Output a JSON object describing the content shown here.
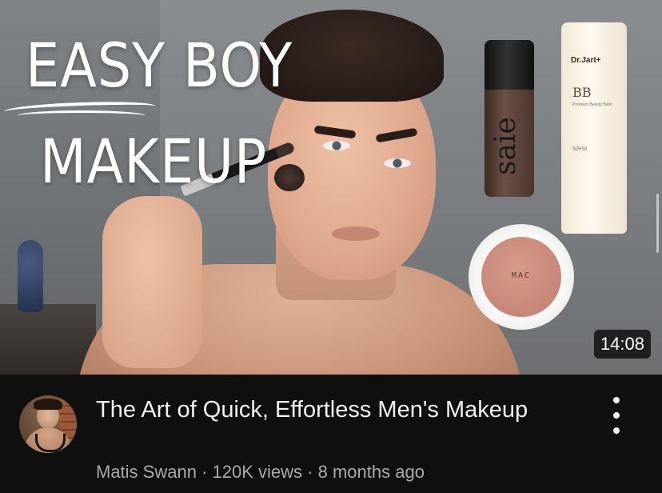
{
  "thumbnail": {
    "headline_line1": "EASY BOY",
    "headline_line2": "MAKEUP",
    "duration": "14:08",
    "products": {
      "foundation_label": "saie",
      "tube_brand": "Dr.Jart+",
      "tube_bb": "BB",
      "tube_text": "Premium Beauty Balm",
      "tube_spf": "SPF50",
      "compact_logo": "MAC"
    }
  },
  "video": {
    "title": "The Art of Quick, Effortless Men's Makeup",
    "channel": "Matis Swann",
    "views": "120K views",
    "age": "8 months ago",
    "separator": "·"
  },
  "colors": {
    "background": "#0f0f0f",
    "title_text": "#f1f1f1",
    "meta_text": "#aaaaaa"
  },
  "icons": {
    "more": "more-vertical-icon"
  }
}
